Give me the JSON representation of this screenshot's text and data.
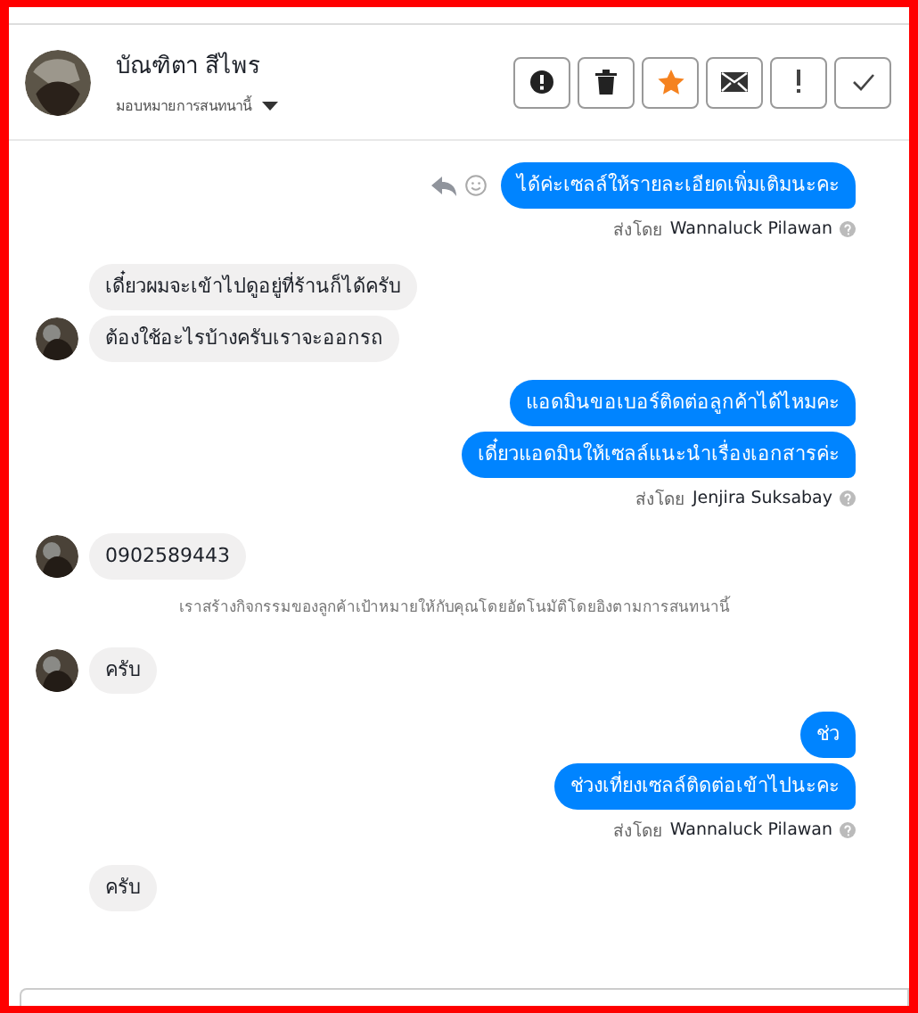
{
  "contact": {
    "name": "บัณฑิตา สีไพร",
    "subtitle": "มอบหมายการสนทนานี้"
  },
  "toolbar": [
    {
      "kind": "alert"
    },
    {
      "kind": "trash"
    },
    {
      "kind": "star"
    },
    {
      "kind": "mail"
    },
    {
      "kind": "exclaim"
    },
    {
      "kind": "check"
    }
  ],
  "messages": [
    {
      "kind": "out",
      "text": "ได้ค่ะเซลล์ให้รายละเอียดเพิ่มเติมนะคะ",
      "actions": true
    },
    {
      "kind": "sender",
      "prefix": "ส่งโดย",
      "name": "Wannaluck Pilawan"
    },
    {
      "kind": "in",
      "text": "เดี๋ยวผมจะเข้าไปดูอยู่ที่ร้านก็ได้ครับ",
      "avatar": false
    },
    {
      "kind": "in",
      "text": "ต้องใช้อะไรบ้างครับเราจะออกรถ",
      "avatar": true
    },
    {
      "kind": "out",
      "text": "แอดมินขอเบอร์ติดต่อลูกค้าได้ไหมคะ",
      "actions": false
    },
    {
      "kind": "out",
      "text": "เดี๋ยวแอดมินให้เซลล์แนะนำเรื่องเอกสารค่ะ",
      "actions": false
    },
    {
      "kind": "sender",
      "prefix": "ส่งโดย",
      "name": "Jenjira Suksabay"
    },
    {
      "kind": "in",
      "text": "0902589443",
      "avatar": true
    },
    {
      "kind": "system",
      "text": "เราสร้างกิจกรรมของลูกค้าเป้าหมายให้กับคุณโดยอัตโนมัติโดยอิงตามการสนทนานี้"
    },
    {
      "kind": "in",
      "text": "ครับ",
      "avatar": true
    },
    {
      "kind": "out",
      "text": "ช่ว",
      "actions": false
    },
    {
      "kind": "out",
      "text": "ช่วงเที่ยงเซลล์ติดต่อเข้าไปนะคะ",
      "actions": false
    },
    {
      "kind": "sender",
      "prefix": "ส่งโดย",
      "name": "Wannaluck Pilawan"
    },
    {
      "kind": "in",
      "text": "ครับ",
      "avatar": false
    }
  ]
}
